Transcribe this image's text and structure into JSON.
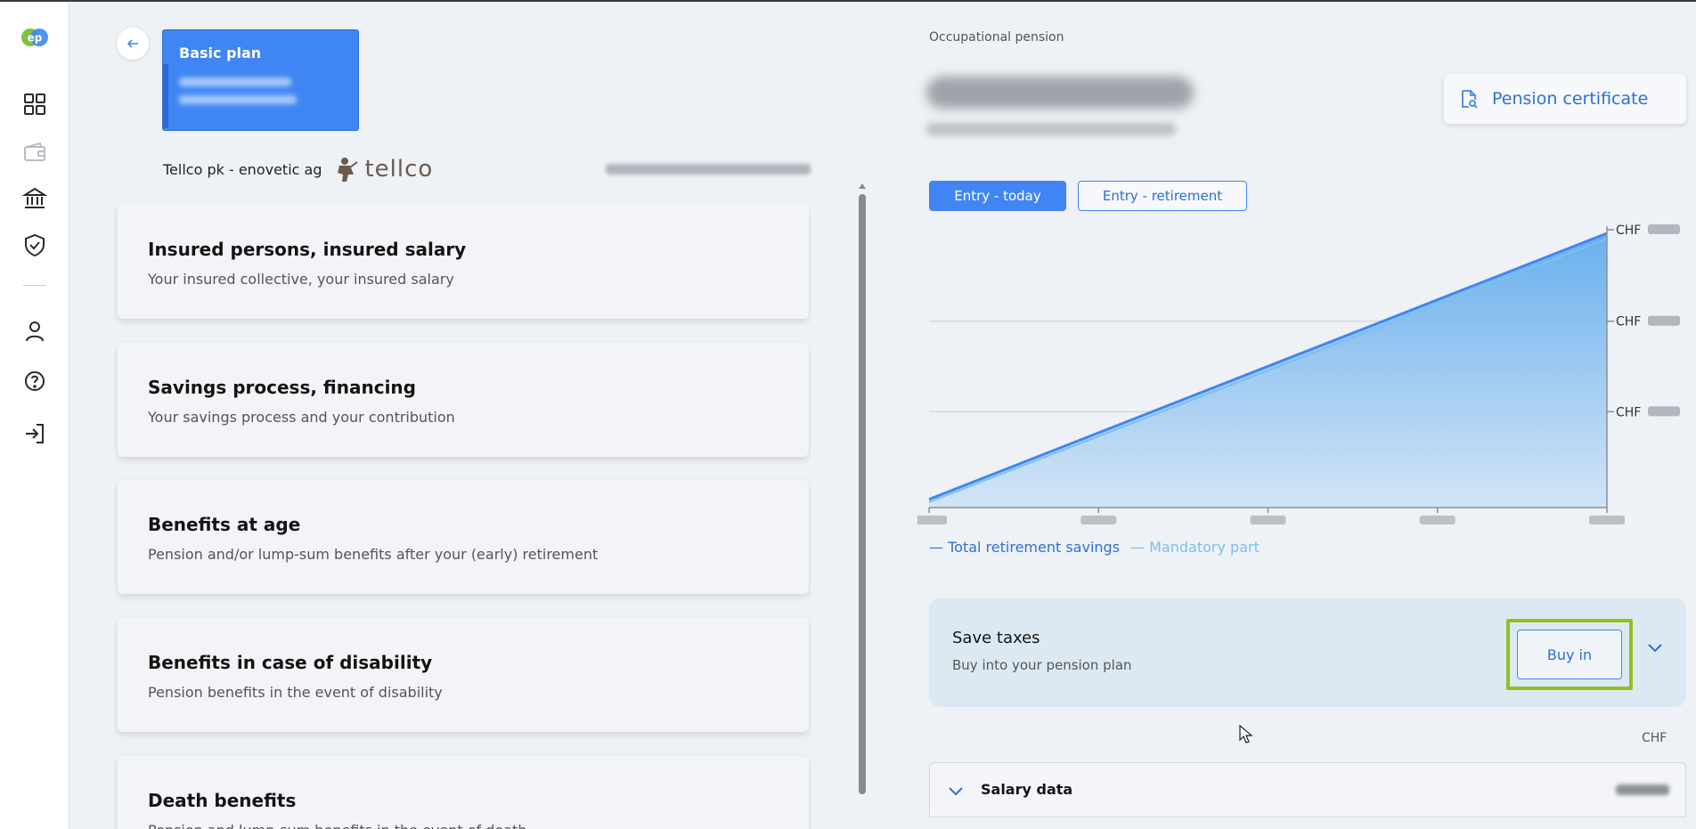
{
  "sidebar": {
    "logo_text": "ep",
    "icons": [
      "dashboard-icon",
      "wallet-icon",
      "bank-icon",
      "shield-check-icon",
      "user-icon",
      "help-icon",
      "logout-icon"
    ]
  },
  "plan_card": {
    "title": "Basic plan"
  },
  "fund": {
    "name": "Tellco pk - enovetic ag",
    "logo_word": "tellco"
  },
  "sections": [
    {
      "title": "Insured persons, insured salary",
      "subtitle": "Your insured collective, your insured salary"
    },
    {
      "title": "Savings process, financing",
      "subtitle": "Your savings process and your contribution"
    },
    {
      "title": "Benefits at age",
      "subtitle": "Pension and/or lump-sum benefits after your (early) retirement"
    },
    {
      "title": "Benefits in case of disability",
      "subtitle": "Pension benefits in the event of disability"
    },
    {
      "title": "Death benefits",
      "subtitle": "Pension and lump-sum benefits in the event of death"
    }
  ],
  "right": {
    "section_label": "Occupational pension",
    "certificate_label": "Pension certificate",
    "toggle_active": "Entry - today",
    "toggle_inactive": "Entry - retirement",
    "currency": "CHF"
  },
  "chart_data": {
    "type": "area",
    "series": [
      {
        "name": "Total retirement savings",
        "values": [
          0.03,
          1.0
        ]
      },
      {
        "name": "Mandatory part",
        "values": [
          0.02,
          0.98
        ]
      }
    ],
    "y_tick_prefix": "CHF",
    "colors": {
      "total": "#3f86f4",
      "mandatory": "#7cc0ec"
    }
  },
  "taxes": {
    "title": "Save taxes",
    "subtitle": "Buy into your pension plan",
    "button": "Buy in"
  },
  "salary": {
    "label": "Salary data"
  }
}
